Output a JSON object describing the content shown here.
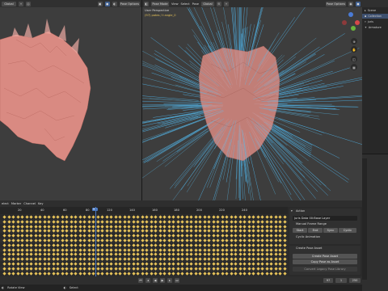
{
  "left_header": {
    "mode": "Global",
    "pose_options": "Pose Options"
  },
  "right_header": {
    "mode": "Pose Mode",
    "menus": [
      "View",
      "Select",
      "Pose"
    ],
    "transform": "Global",
    "pose_options": "Pose Options"
  },
  "viewport": {
    "title": "User Perspective",
    "subtitle": "(97) pates / t angle_0"
  },
  "timeline": {
    "menus": [
      "elect",
      "Marker",
      "Channel",
      "Key"
    ],
    "frame_ticks": [
      "20",
      "40",
      "60",
      "80",
      "97",
      "120",
      "140",
      "160",
      "180",
      "200",
      "220",
      "240"
    ],
    "current_frame": "97",
    "rows": 13,
    "start": "1",
    "end": "250",
    "current": "97"
  },
  "action_panel": {
    "header": "Action",
    "action_name": "juris Data 00:Base Layer",
    "manual_frame_range": "Manual Frame Range",
    "buttons": [
      "Start",
      "End",
      "Sync",
      "Cyclic"
    ],
    "cyclic_animation": "Cyclic Animation",
    "pose_asset_header": "Create Pose Asset",
    "create_pose_asset": "Create Pose Asset",
    "copy_pose_as_asset": "Copy Pose as Asset",
    "paste_legacy": "Convert Legacy Pose Library"
  },
  "outliner": {
    "items": [
      "Scene",
      "Collection",
      "juris",
      "Armature"
    ]
  },
  "status": {
    "items": [
      "Rotate View",
      "Select"
    ]
  },
  "colors": {
    "keyframe": "#e8c45a",
    "hair": "#4fb3e8",
    "brain": "#d98a82"
  }
}
